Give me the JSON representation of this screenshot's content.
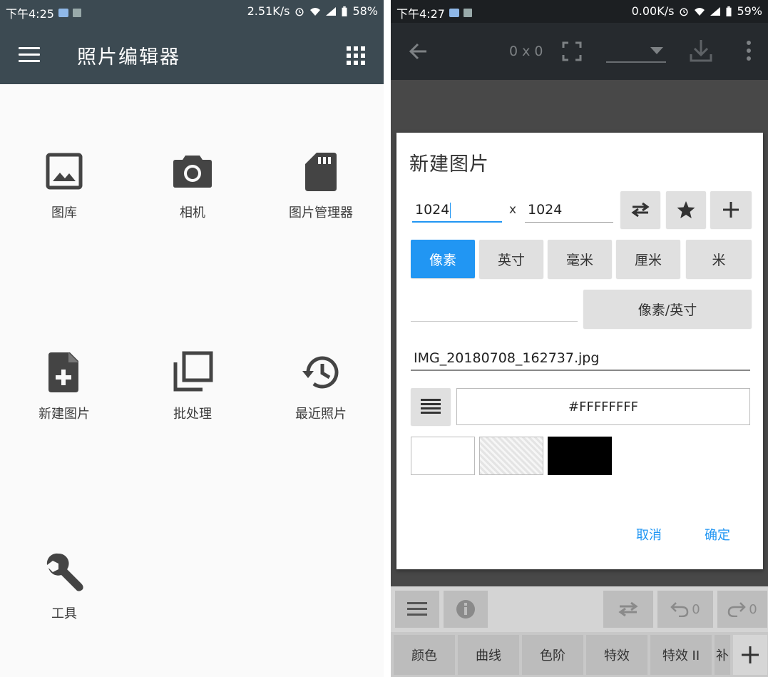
{
  "left_screen": {
    "status": {
      "time": "下午4:25",
      "speed": "2.51K/s",
      "battery": "58%"
    },
    "app_title": "照片编辑器",
    "tiles": [
      {
        "label": "图库",
        "icon": "image-icon"
      },
      {
        "label": "相机",
        "icon": "camera-icon"
      },
      {
        "label": "图片管理器",
        "icon": "sd-card-icon"
      },
      {
        "label": "新建图片",
        "icon": "new-file-icon"
      },
      {
        "label": "批处理",
        "icon": "batch-icon"
      },
      {
        "label": "最近照片",
        "icon": "history-icon"
      },
      {
        "label": "工具",
        "icon": "wrench-icon"
      }
    ]
  },
  "right_screen": {
    "status": {
      "time": "下午4:27",
      "speed": "0.00K/s",
      "battery": "59%"
    },
    "toolbar": {
      "size_text": "0 x 0"
    },
    "dialog": {
      "title": "新建图片",
      "width_value": "1024",
      "times": "x",
      "height_value": "1024",
      "units": [
        "像素",
        "英寸",
        "毫米",
        "厘米",
        "米"
      ],
      "selected_unit": "像素",
      "resolution_label": "像素/英寸",
      "filename": "IMG_20180708_162737.jpg",
      "color_value": "#FFFFFFFF",
      "cancel_label": "取消",
      "ok_label": "确定"
    },
    "bottom_bar": {
      "undo_count": "0",
      "redo_count": "0"
    },
    "tabs": [
      "颜色",
      "曲线",
      "色阶",
      "特效",
      "特效 II",
      "补"
    ]
  },
  "colors": {
    "appbar": "#3c4a52",
    "accent": "#2196f3",
    "toolbar_dark": "#262a2e"
  }
}
